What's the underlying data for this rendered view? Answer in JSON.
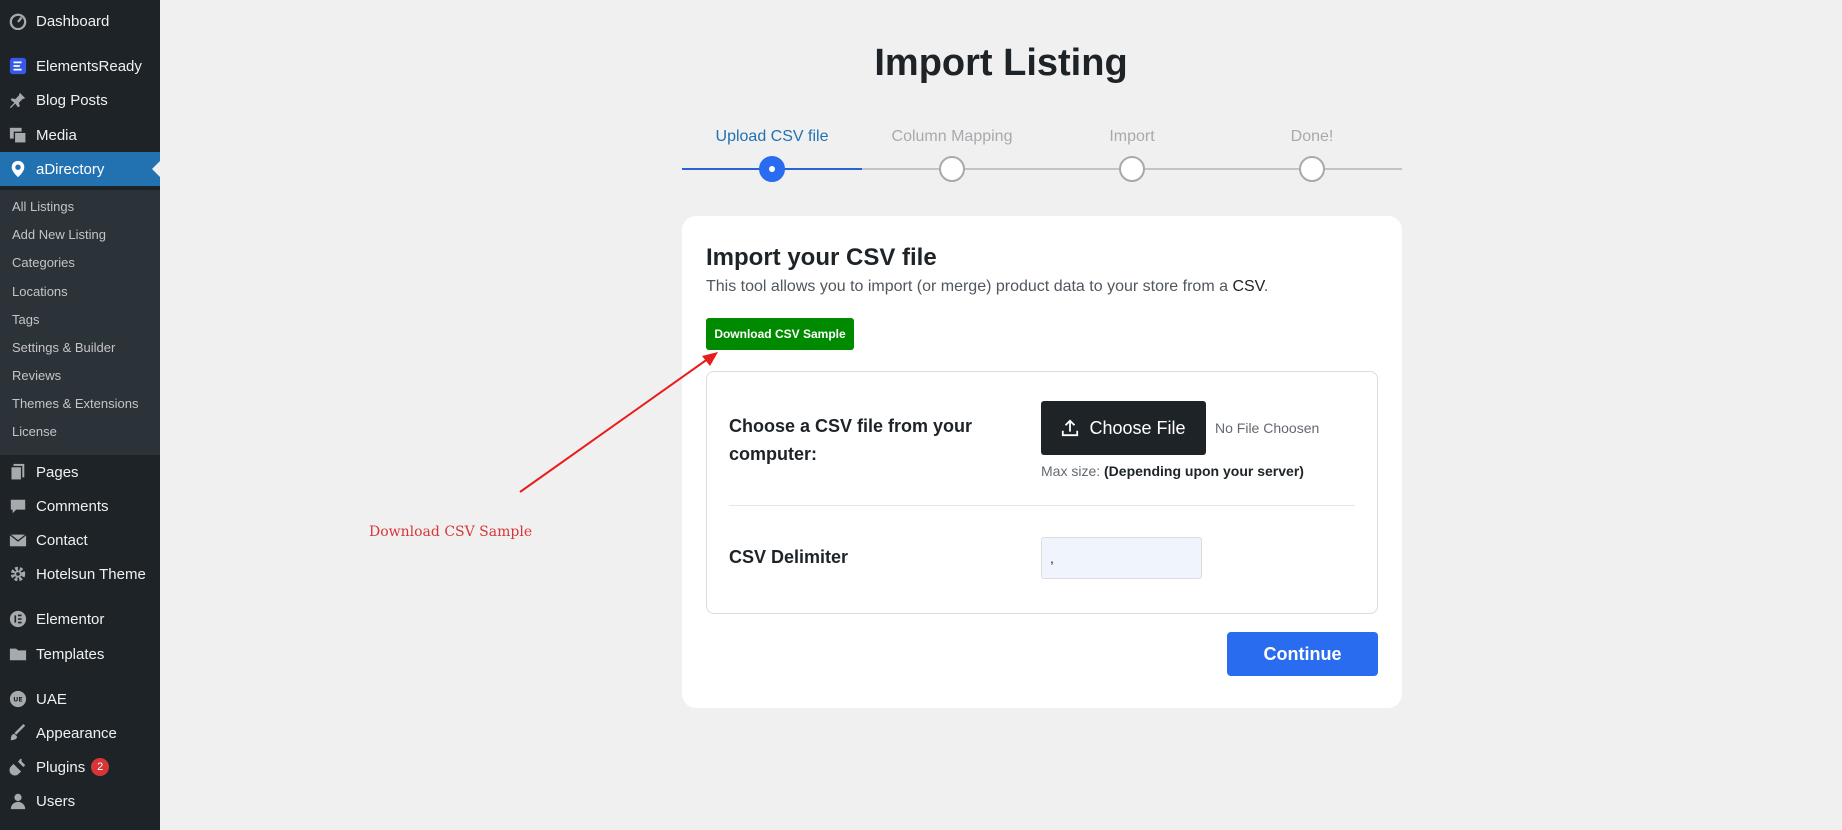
{
  "sidebar": {
    "items": [
      {
        "label": "Dashboard",
        "icon": "dashboard-icon"
      },
      {
        "label": "ElementsReady",
        "icon": "elementsready-icon"
      },
      {
        "label": "Blog Posts",
        "icon": "pin-icon"
      },
      {
        "label": "Media",
        "icon": "media-icon"
      },
      {
        "label": "aDirectory",
        "icon": "location-pin-icon"
      },
      {
        "label": "Pages",
        "icon": "pages-icon"
      },
      {
        "label": "Comments",
        "icon": "comment-icon"
      },
      {
        "label": "Contact",
        "icon": "mail-icon"
      },
      {
        "label": "Hotelsun Theme",
        "icon": "gear-icon"
      },
      {
        "label": "Elementor",
        "icon": "elementor-icon"
      },
      {
        "label": "Templates",
        "icon": "folder-icon"
      },
      {
        "label": "UAE",
        "icon": "uae-icon"
      },
      {
        "label": "Appearance",
        "icon": "brush-icon"
      },
      {
        "label": "Plugins",
        "icon": "plug-icon",
        "badge": "2"
      },
      {
        "label": "Users",
        "icon": "user-icon"
      }
    ],
    "submenu": [
      "All Listings",
      "Add New Listing",
      "Categories",
      "Locations",
      "Tags",
      "Settings & Builder",
      "Reviews",
      "Themes & Extensions",
      "License"
    ]
  },
  "page": {
    "title": "Import Listing"
  },
  "stepper": {
    "steps": [
      "Upload CSV file",
      "Column Mapping",
      "Import",
      "Done!"
    ],
    "active_step": 1
  },
  "card": {
    "title": "Import your CSV file",
    "description": "This tool allows you to import (or merge) product data to your store from a ",
    "description_strong": "CSV",
    "description_end": ".",
    "download_label": "Download CSV Sample",
    "file_label": "Choose a CSV file from your computer:",
    "choose_file_label": "Choose File",
    "no_file_text": "No File Choosen",
    "max_size_label": "Max size:",
    "max_size_value": "(Depending upon your server)",
    "delimiter_label": "CSV Delimiter",
    "delimiter_value": ",",
    "continue_label": "Continue"
  },
  "annotation": {
    "text": "Download CSV Sample"
  },
  "colors": {
    "sidebar_bg": "#1d2327",
    "active_menu": "#2271b1",
    "primary_blue": "#2a6cf0",
    "download_green": "#008a00",
    "annotation_red": "#d63638"
  }
}
